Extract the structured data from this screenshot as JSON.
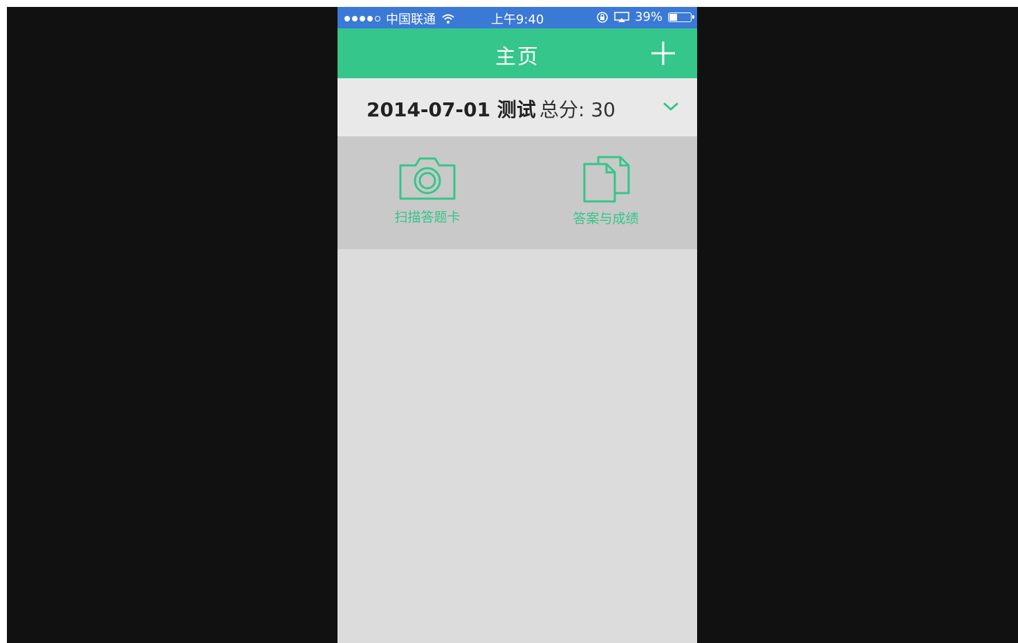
{
  "status_bar": {
    "carrier": "中国联通",
    "time": "上午9:40",
    "battery_text": "39%",
    "battery_level": 0.39,
    "icons": [
      "signal-dots-icon",
      "wifi-icon",
      "rotation-lock-icon",
      "airplay-icon",
      "battery-icon"
    ]
  },
  "nav": {
    "title": "主页",
    "add_icon": "plus-icon"
  },
  "exam": {
    "title": "2014-07-01 测试",
    "score_label": "总分: 30",
    "toggle_icon": "chevron-down-icon"
  },
  "actions": {
    "scan_label": "扫描答题卡",
    "scan_icon": "camera-icon",
    "answers_label": "答案与成绩",
    "answers_icon": "documents-icon"
  },
  "colors": {
    "status_bar": "#3b79d6",
    "accent": "#34c68a",
    "exam_row": "#e9e9e9",
    "action_panel": "#c9c9c9",
    "content_bg": "#dcdcdc"
  }
}
